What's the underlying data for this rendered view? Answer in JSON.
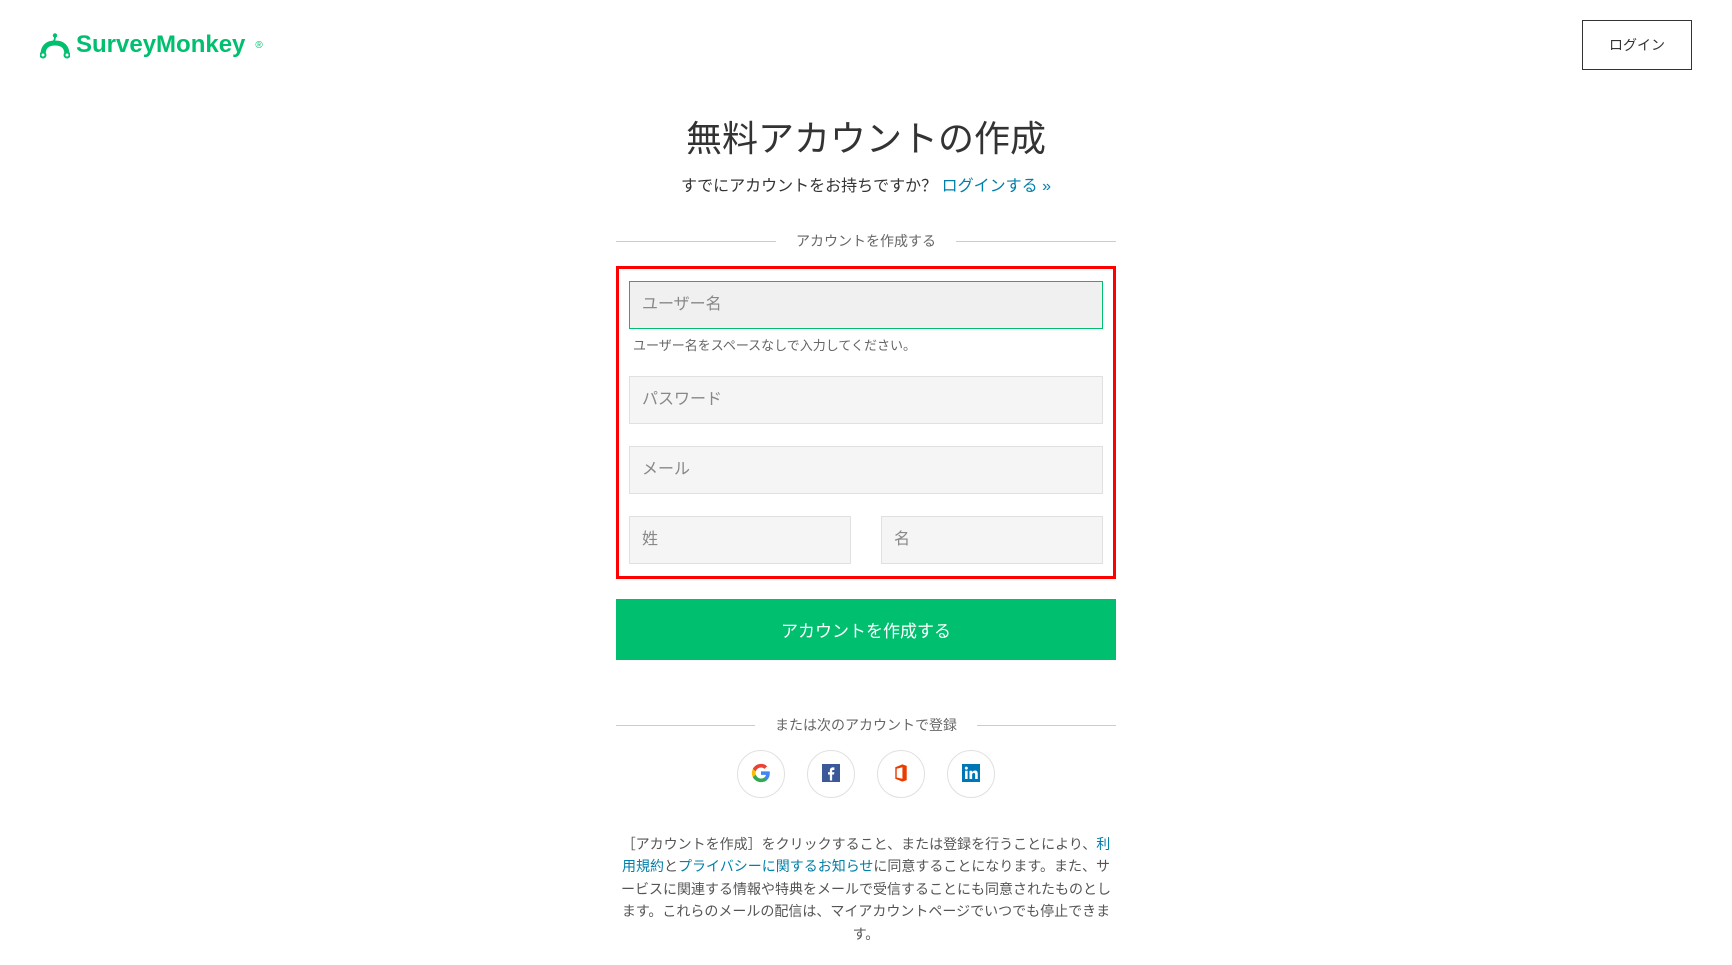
{
  "header": {
    "logo_text": "SurveyMonkey",
    "login_label": "ログイン"
  },
  "page": {
    "title": "無料アカウントの作成",
    "subtitle_prefix": "すでにアカウントをお持ちですか？",
    "login_link": "ログインする »"
  },
  "divider": {
    "create_account": "アカウントを作成する",
    "or_register": "または次のアカウントで登録"
  },
  "form": {
    "username_placeholder": "ユーザー名",
    "username_helper": "ユーザー名をスペースなしで入力してください。",
    "password_placeholder": "パスワード",
    "email_placeholder": "メール",
    "lastname_placeholder": "姓",
    "firstname_placeholder": "名",
    "submit_label": "アカウントを作成する"
  },
  "social": {
    "google": "Google",
    "facebook": "Facebook",
    "office": "Office 365",
    "linkedin": "LinkedIn"
  },
  "legal": {
    "part1": "［アカウントを作成］をクリックすること、または登録を行うことにより、",
    "terms_link": "利用規約",
    "part2": "と",
    "privacy_link": "プライバシーに関するお知らせ",
    "part3": "に同意することになります。また、サービスに関連する情報や特典をメールで受信することにも同意されたものとします。これらのメールの配信は、マイアカウントページでいつでも停止できます。"
  }
}
